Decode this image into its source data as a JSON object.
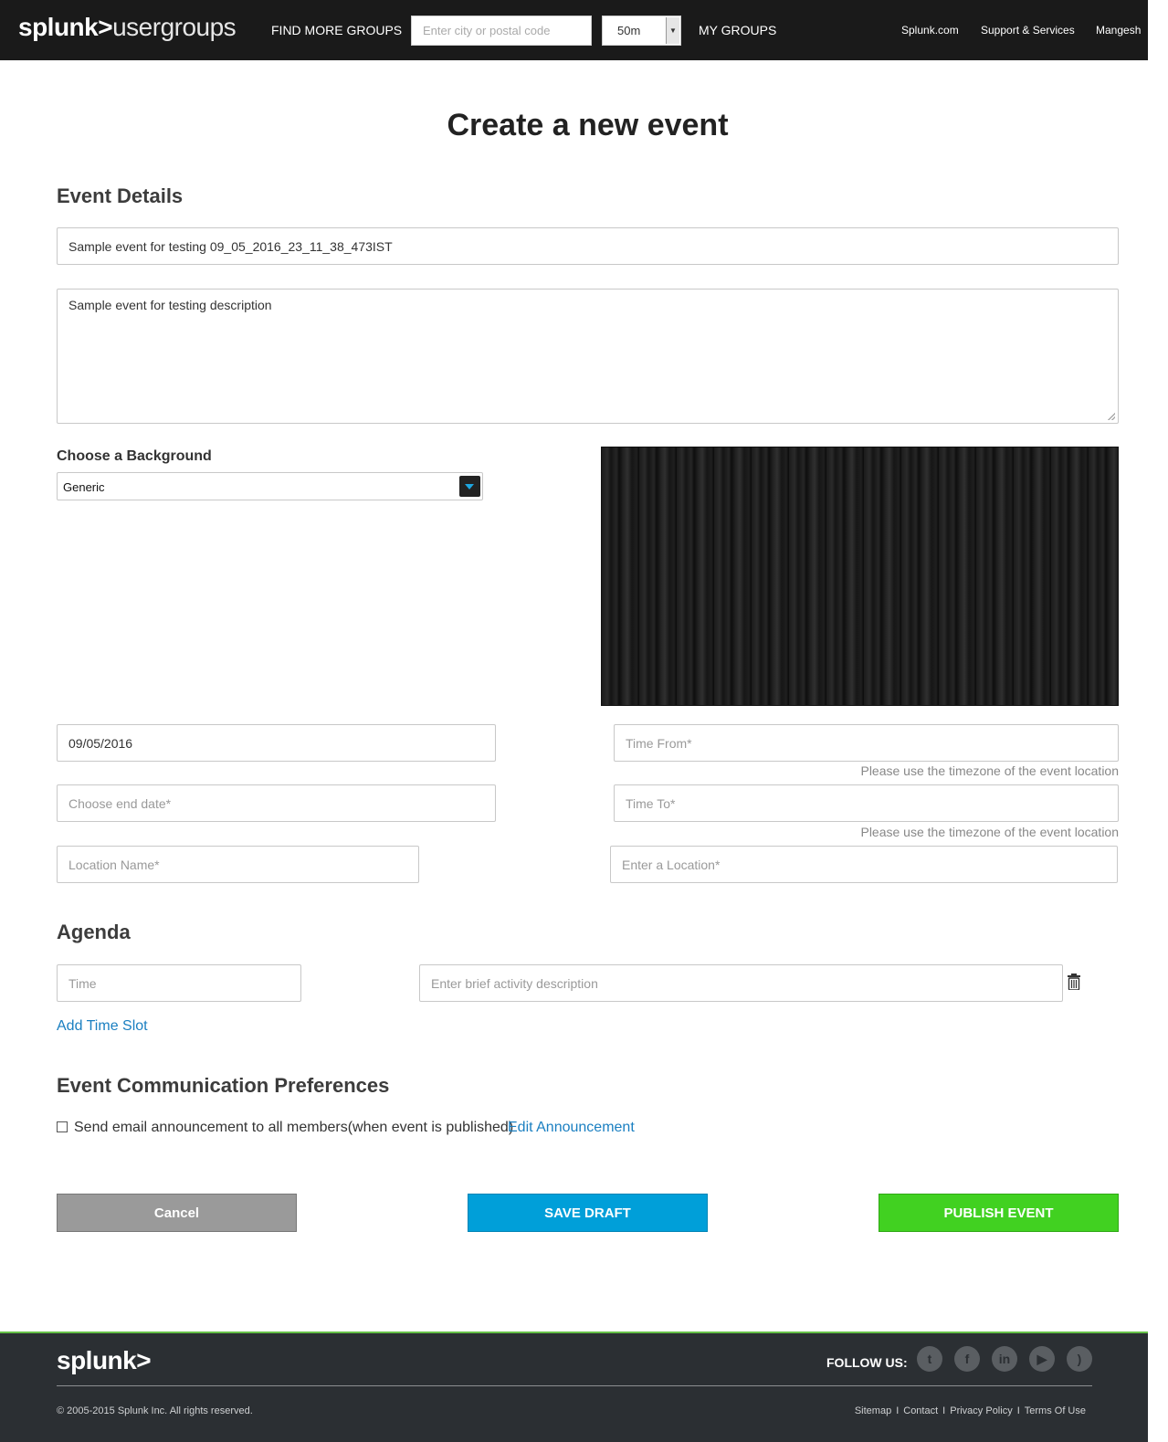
{
  "header": {
    "logo_brand": "splunk>",
    "logo_suffix": "usergroups",
    "find_more_groups": "FIND MORE GROUPS",
    "search_placeholder": "Enter city or postal code",
    "distance_value": "50m",
    "my_groups": "MY GROUPS",
    "splunk_com": "Splunk.com",
    "support": "Support & Services",
    "user": "Mangesh"
  },
  "page": {
    "title": "Create a new event"
  },
  "event_details": {
    "heading": "Event Details",
    "name_value": "Sample event for testing  09_05_2016_23_11_38_473IST",
    "description_value": "Sample event for testing  description",
    "background_label": "Choose a Background",
    "background_selected": "Generic",
    "start_date_value": "09/05/2016",
    "time_from_placeholder": "Time From*",
    "timezone_note": "Please use the timezone of the event location",
    "end_date_placeholder": "Choose end date*",
    "time_to_placeholder": "Time To*",
    "location_name_placeholder": "Location Name*",
    "location_placeholder": "Enter a Location*"
  },
  "agenda": {
    "heading": "Agenda",
    "time_placeholder": "Time",
    "activity_placeholder": "Enter brief activity description",
    "add_slot": "Add Time Slot"
  },
  "communication": {
    "heading": "Event Communication Preferences",
    "email_checkbox_label": "Send email announcement to all members(when event is published)",
    "edit_announcement": "Edit Announcement"
  },
  "actions": {
    "cancel": "Cancel",
    "save_draft": "SAVE DRAFT",
    "publish": "PUBLISH EVENT"
  },
  "footer": {
    "logo": "splunk>",
    "follow_us": "FOLLOW US:",
    "social_icons": [
      "twitter-icon",
      "facebook-icon",
      "linkedin-icon",
      "youtube-icon",
      "rss-icon"
    ],
    "copyright": "© 2005-2015 Splunk Inc. All rights reserved.",
    "links": [
      "Sitemap",
      "Contact",
      "Privacy Policy",
      "Terms Of Use"
    ]
  },
  "colors": {
    "header_bg": "#1a1a1a",
    "link": "#1a7fc1",
    "cancel": "#9a9a9a",
    "save": "#009fd9",
    "publish": "#41d121",
    "footer_bg": "#2b2f33"
  }
}
